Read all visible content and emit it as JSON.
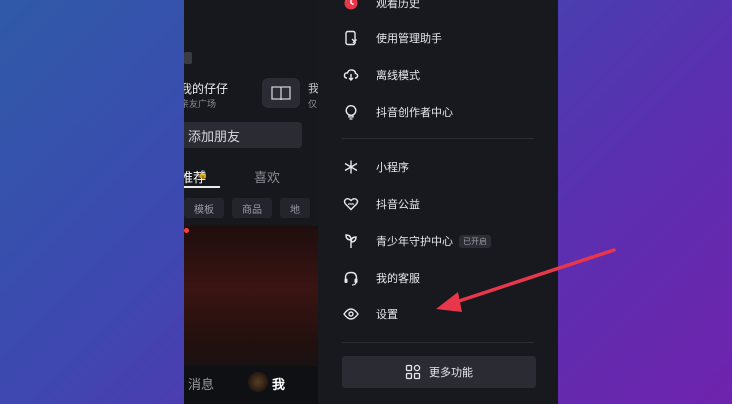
{
  "profile": {
    "name": "我的仔仔",
    "subtitle": "亲友广场",
    "edge_text": "我",
    "edge_sub": "仅",
    "add_friend_label": "添加朋友",
    "tabs": [
      "推荐",
      "喜欢"
    ],
    "chips": [
      "模板",
      "商品",
      "地"
    ],
    "bottom_nav": {
      "messages": "消息",
      "me": "我"
    }
  },
  "drawer": {
    "items": [
      {
        "label": "观看历史",
        "icon": "history-icon"
      },
      {
        "label": "使用管理助手",
        "icon": "phone-manager-icon"
      },
      {
        "label": "离线模式",
        "icon": "cloud-download-icon"
      },
      {
        "label": "抖音创作者中心",
        "icon": "lightbulb-icon"
      },
      {
        "label": "小程序",
        "icon": "asterisk-icon"
      },
      {
        "label": "抖音公益",
        "icon": "heart-hands-icon"
      },
      {
        "label": "青少年守护中心",
        "icon": "sprout-icon",
        "badge": "已开启"
      },
      {
        "label": "我的客服",
        "icon": "headset-icon"
      },
      {
        "label": "设置",
        "icon": "settings-icon"
      }
    ],
    "more_button_label": "更多功能"
  },
  "annotation": {
    "arrow_color": "#e8374a"
  }
}
